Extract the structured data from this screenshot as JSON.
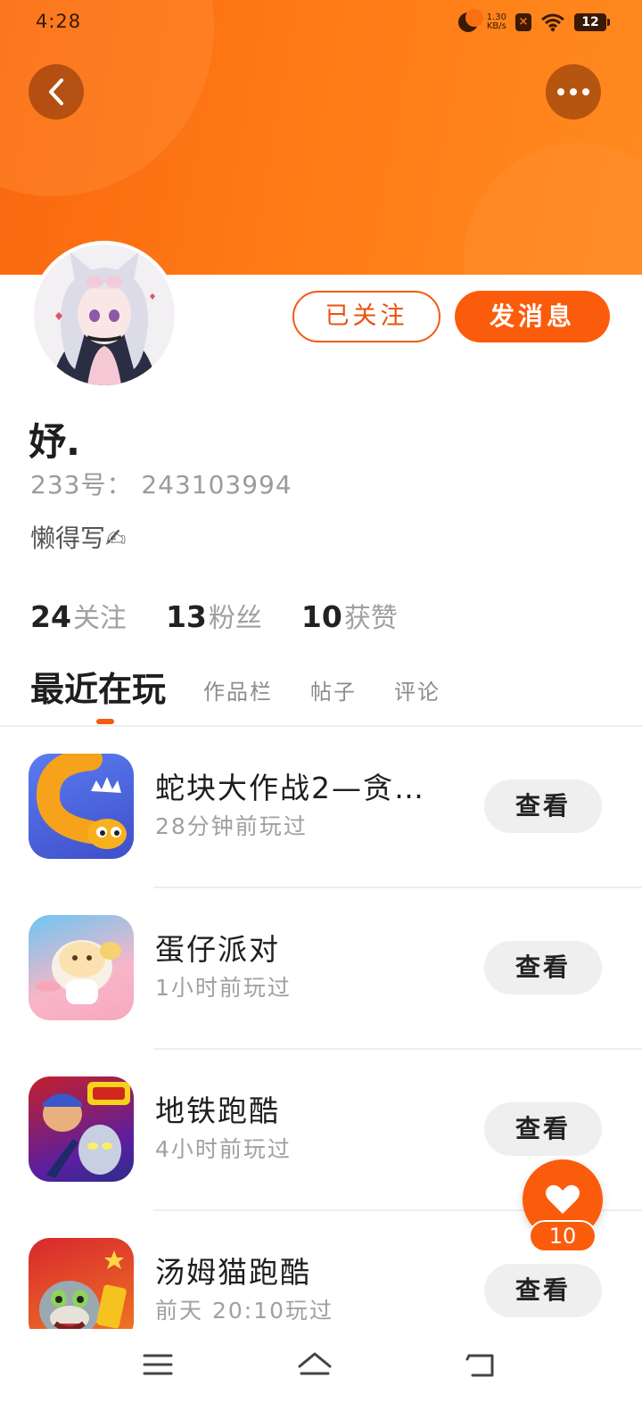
{
  "status_bar": {
    "time": "4:28",
    "net_speed_top": "1.30",
    "net_speed_bottom": "KB/s",
    "battery": "12"
  },
  "header": {
    "back_icon": "chevron-left-icon",
    "more_icon": "more-dots-icon",
    "accent_color": "#fb5c0c"
  },
  "profile": {
    "username": "妤.",
    "id_text": "233号： 243103994",
    "bio": "懒得写✍",
    "follow_label": "已关注",
    "message_label": "发消息"
  },
  "stats": [
    {
      "num": "24",
      "label": "关注"
    },
    {
      "num": "13",
      "label": "粉丝"
    },
    {
      "num": "10",
      "label": "获赞"
    }
  ],
  "tabs": {
    "active": "最近在玩",
    "others": [
      "作品栏",
      "帖子",
      "评论"
    ]
  },
  "games": [
    {
      "title": "蛇块大作战2—贪…",
      "time": "28分钟前玩过",
      "button": "查看"
    },
    {
      "title": "蛋仔派对",
      "time": "1小时前玩过",
      "button": "查看"
    },
    {
      "title": "地铁跑酷",
      "time": "4小时前玩过",
      "button": "查看"
    },
    {
      "title": "汤姆猫跑酷",
      "time": "前天 20:10玩过",
      "button": "查看"
    }
  ],
  "like_fab": {
    "count": "10",
    "icon": "heart-icon"
  },
  "nav": {
    "icons": [
      "menu-icon",
      "home-icon",
      "back-nav-icon"
    ]
  }
}
